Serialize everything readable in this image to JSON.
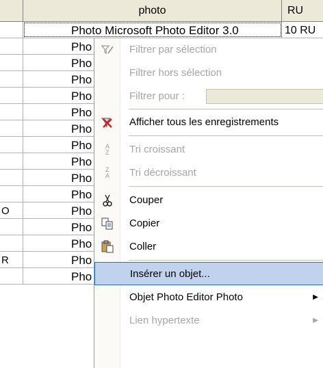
{
  "table": {
    "columns": [
      "",
      "photo",
      "RU"
    ],
    "rows": [
      {
        "a": "",
        "photo": "Photo Microsoft Photo Editor 3.0",
        "c": "10 RU"
      },
      {
        "a": "",
        "photo": "Pho",
        "c": ""
      },
      {
        "a": "",
        "photo": "Pho",
        "c": ""
      },
      {
        "a": "",
        "photo": "Pho",
        "c": ""
      },
      {
        "a": "",
        "photo": "Pho",
        "c": ""
      },
      {
        "a": "",
        "photo": "Pho",
        "c": ""
      },
      {
        "a": "",
        "photo": "Pho",
        "c": ""
      },
      {
        "a": "",
        "photo": "Pho",
        "c": ""
      },
      {
        "a": "",
        "photo": "Pho",
        "c": ""
      },
      {
        "a": "",
        "photo": "Pho",
        "c": ""
      },
      {
        "a": "",
        "photo": "Pho",
        "c": ""
      },
      {
        "a": "O",
        "photo": "Pho",
        "c": ""
      },
      {
        "a": "",
        "photo": "Pho",
        "c": ""
      },
      {
        "a": "",
        "photo": "Pho",
        "c": ""
      },
      {
        "a": "R",
        "photo": "Pho",
        "c": ""
      },
      {
        "a": "",
        "photo": "Pho",
        "c": ""
      }
    ]
  },
  "menu": {
    "items": [
      {
        "id": "filter-by-selection",
        "label": "Filtrer par sélection",
        "icon": "filter-selection-icon",
        "disabled": true
      },
      {
        "id": "filter-excluding-selection",
        "label": "Filtrer hors sélection",
        "icon": "",
        "disabled": true
      },
      {
        "id": "filter-for",
        "label": "Filtrer pour :",
        "icon": "",
        "disabled": true
      },
      {
        "id": "show-all-records",
        "label": "Afficher tous les enregistrements",
        "icon": "remove-filter-icon",
        "disabled": false
      },
      {
        "id": "sort-ascending",
        "label": "Tri croissant",
        "icon": "sort-ascending-icon",
        "disabled": true
      },
      {
        "id": "sort-descending",
        "label": "Tri décroissant",
        "icon": "sort-descending-icon",
        "disabled": true
      },
      {
        "id": "cut",
        "label": "Couper",
        "icon": "cut-icon",
        "disabled": false
      },
      {
        "id": "copy",
        "label": "Copier",
        "icon": "copy-icon",
        "disabled": false
      },
      {
        "id": "paste",
        "label": "Coller",
        "icon": "paste-icon",
        "disabled": false
      },
      {
        "id": "insert-object",
        "label": "Insérer un objet...",
        "icon": "",
        "disabled": false,
        "highlighted": true
      },
      {
        "id": "photo-editor-object",
        "label": "Objet Photo Editor Photo",
        "icon": "",
        "disabled": false,
        "submenu": true
      },
      {
        "id": "hyperlink",
        "label": "Lien hypertexte",
        "icon": "",
        "disabled": true,
        "submenu": true
      }
    ]
  },
  "colors": {
    "highlight": "#c1d2ee",
    "highlight_border": "#316ac5",
    "disabled_text": "#a6a6a6",
    "remove_filter_red": "#cc2222"
  }
}
